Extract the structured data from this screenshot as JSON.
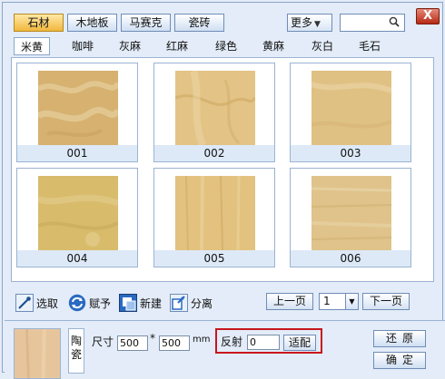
{
  "top_tabs": [
    {
      "label": "石材",
      "active": true
    },
    {
      "label": "木地板",
      "active": false
    },
    {
      "label": "马赛克",
      "active": false
    },
    {
      "label": "瓷砖",
      "active": false
    }
  ],
  "more_label": "更多",
  "close_label": "X",
  "sub_tabs": [
    {
      "label": "米黄",
      "active": true
    },
    {
      "label": "咖啡",
      "active": false
    },
    {
      "label": "灰麻",
      "active": false
    },
    {
      "label": "红麻",
      "active": false
    },
    {
      "label": "绿色",
      "active": false
    },
    {
      "label": "黄麻",
      "active": false
    },
    {
      "label": "灰白",
      "active": false
    },
    {
      "label": "毛石",
      "active": false
    }
  ],
  "tiles": [
    {
      "caption": "001",
      "color": "#d8b876"
    },
    {
      "caption": "002",
      "color": "#e4c489"
    },
    {
      "caption": "003",
      "color": "#e1c386"
    },
    {
      "caption": "004",
      "color": "#d9be6e"
    },
    {
      "caption": "005",
      "color": "#e3c380"
    },
    {
      "caption": "006",
      "color": "#dfc48a"
    }
  ],
  "tools": {
    "pick_label": "选取",
    "assign_label": "赋予",
    "new_label": "新建",
    "separate_label": "分离"
  },
  "pagination": {
    "prev_label": "上一页",
    "page_value": "1",
    "next_label": "下一页"
  },
  "bottom": {
    "material_type": "陶瓷",
    "size_label": "尺寸",
    "width_value": "500",
    "times_symbol": "*",
    "height_value": "500",
    "unit_label": "mm",
    "reflect_label": "反射",
    "reflect_value": "0",
    "apply_label": "适配",
    "restore_label": "还原",
    "confirm_label": "确定"
  },
  "colors": {
    "accent_tab": "#f1b73c",
    "highlight_border": "#c8161d",
    "panel_bg": "#e3ecf8"
  }
}
